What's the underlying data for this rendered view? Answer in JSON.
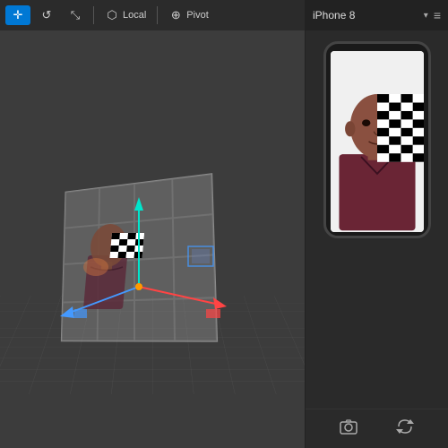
{
  "toolbar": {
    "tools": [
      {
        "id": "move",
        "label": "",
        "icon": "✛",
        "active": true
      },
      {
        "id": "rotate",
        "label": "",
        "icon": "↺",
        "active": false
      },
      {
        "id": "scale",
        "label": "",
        "icon": "⤡",
        "active": false
      }
    ],
    "mode_local": {
      "label": "Local",
      "icon": "⬡"
    },
    "mode_pivot": {
      "label": "Pivot",
      "icon": "⊕"
    }
  },
  "phone_panel": {
    "title": "iPhone 8",
    "dropdown_char": "▾",
    "menu_char": "≡",
    "bottom_buttons": [
      {
        "id": "camera-btn",
        "icon": "⊙",
        "label": "camera"
      },
      {
        "id": "flip-btn",
        "icon": "⟲",
        "label": "flip"
      }
    ]
  },
  "scene": {
    "gizmo": {
      "up_color": "#00e5cc",
      "right_color": "#ff4444",
      "left_color": "#4499ff",
      "forward_color": "#ff9900"
    }
  }
}
